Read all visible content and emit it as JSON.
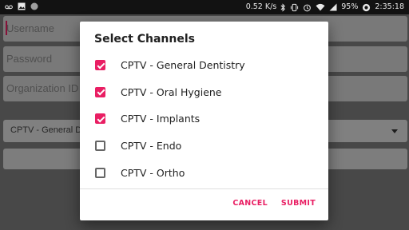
{
  "statusbar": {
    "speed": "0.52 K/s",
    "battery": "95%",
    "time": "2:35:18"
  },
  "form": {
    "username_placeholder": "Username",
    "password_placeholder": "Password",
    "org_placeholder": "Organization ID",
    "channel_value": "CPTV - General De"
  },
  "dialog": {
    "title": "Select Channels",
    "items": [
      {
        "label": "CPTV - General Dentistry",
        "checked": true
      },
      {
        "label": "CPTV - Oral Hygiene",
        "checked": true
      },
      {
        "label": "CPTV - Implants",
        "checked": true
      },
      {
        "label": "CPTV - Endo",
        "checked": false
      },
      {
        "label": "CPTV - Ortho",
        "checked": false
      }
    ],
    "cancel_label": "CANCEL",
    "submit_label": "SUBMIT"
  },
  "colors": {
    "accent": "#e91e63"
  }
}
